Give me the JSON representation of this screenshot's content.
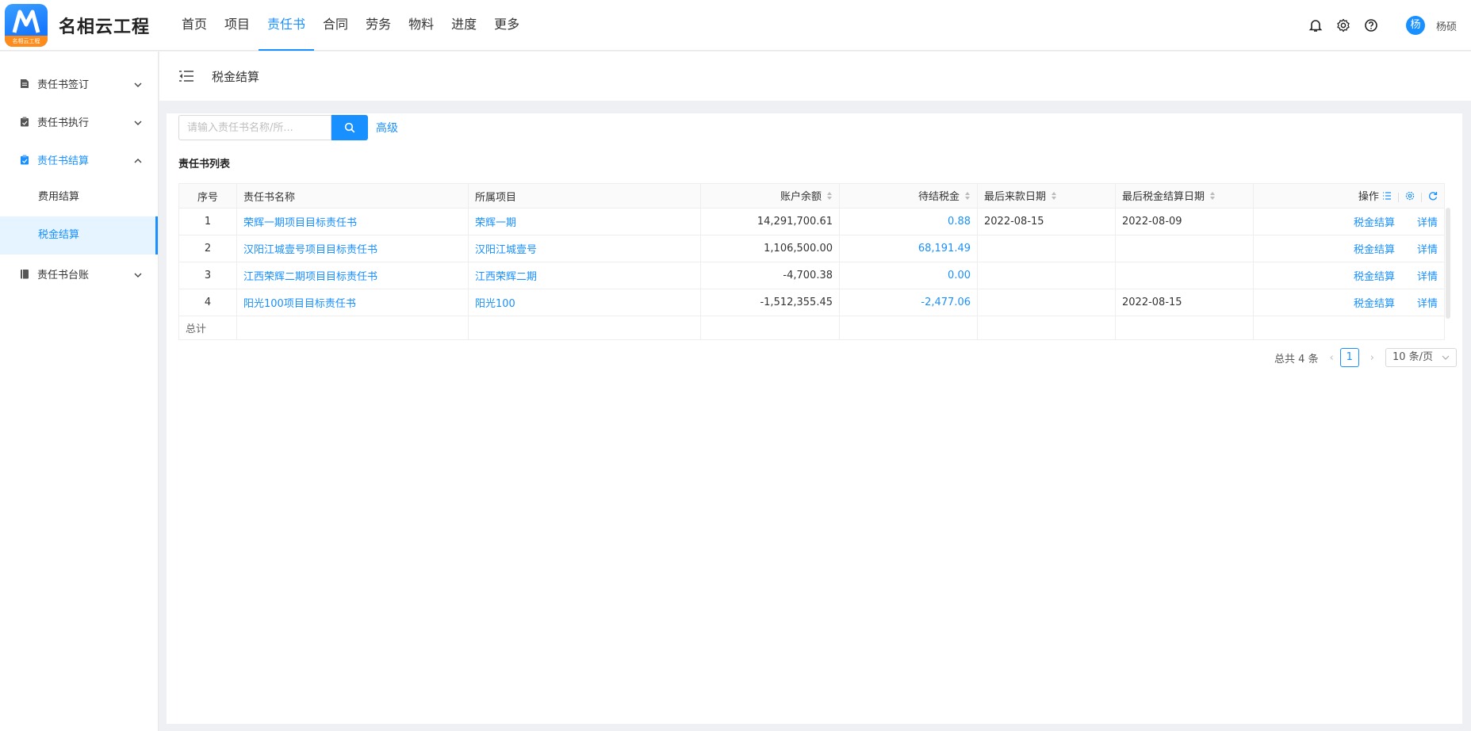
{
  "app": {
    "title": "名相云工程",
    "logo_band": "名相云工程"
  },
  "nav": {
    "items": [
      "首页",
      "项目",
      "责任书",
      "合同",
      "劳务",
      "物料",
      "进度",
      "更多"
    ],
    "active_index": 2
  },
  "user": {
    "avatar": "杨",
    "name": "杨硕"
  },
  "sidebar": {
    "menus": [
      {
        "label": "责任书签订",
        "icon": "document-icon"
      },
      {
        "label": "责任书执行",
        "icon": "clipboard-icon"
      },
      {
        "label": "责任书结算",
        "icon": "settlement-icon"
      },
      {
        "label": "责任书台账",
        "icon": "ledger-icon"
      }
    ],
    "submenus": [
      "费用结算",
      "税金结算"
    ],
    "open_menu_index": 2,
    "active_submenu_index": 1
  },
  "breadcrumb": {
    "title": "税金结算"
  },
  "search": {
    "placeholder": "请输入责任书名称/所...",
    "advanced_label": "高级"
  },
  "list": {
    "title": "责任书列表",
    "columns": {
      "index": "序号",
      "name": "责任书名称",
      "project": "所属项目",
      "balance": "账户余额",
      "pending_tax": "待结税金",
      "last_payment_date": "最后来款日期",
      "last_tax_date": "最后税金结算日期",
      "actions": "操作"
    },
    "rows": [
      {
        "index": "1",
        "name": "荣辉一期项目目标责任书",
        "project": "荣辉一期",
        "balance": "14,291,700.61",
        "pending_tax": "0.88",
        "last_payment_date": "2022-08-15",
        "last_tax_date": "2022-08-09"
      },
      {
        "index": "2",
        "name": "汉阳江城壹号项目目标责任书",
        "project": "汉阳江城壹号",
        "balance": "1,106,500.00",
        "pending_tax": "68,191.49",
        "last_payment_date": "",
        "last_tax_date": ""
      },
      {
        "index": "3",
        "name": "江西荣辉二期项目目标责任书",
        "project": "江西荣辉二期",
        "balance": "-4,700.38",
        "pending_tax": "0.00",
        "last_payment_date": "",
        "last_tax_date": ""
      },
      {
        "index": "4",
        "name": "阳光100项目目标责任书",
        "project": "阳光100",
        "balance": "-1,512,355.45",
        "pending_tax": "-2,477.06",
        "last_payment_date": "",
        "last_tax_date": "2022-08-15"
      }
    ],
    "row_actions": {
      "settle": "税金结算",
      "detail": "详情"
    },
    "total_label": "总计"
  },
  "pagination": {
    "total_text": "总共 4 条",
    "current_page": "1",
    "page_size": "10 条/页"
  },
  "colors": {
    "accent": "#1890ff",
    "logo_band": "#ff8c1a"
  }
}
